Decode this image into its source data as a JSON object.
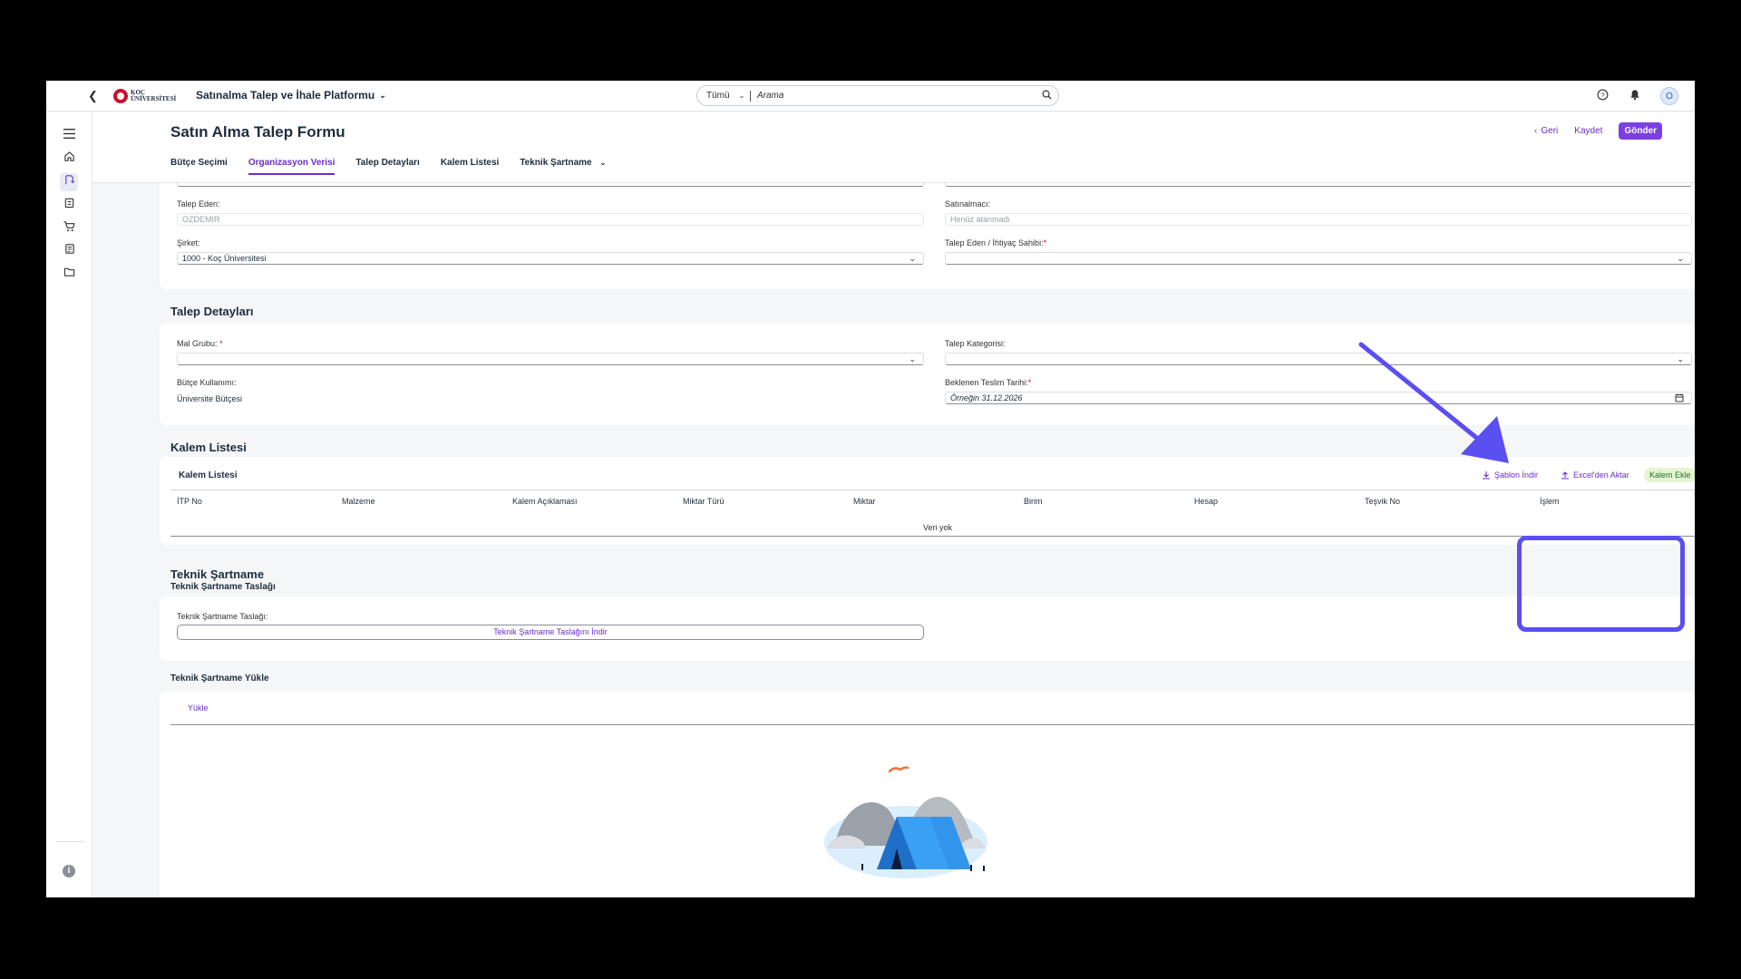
{
  "shell": {
    "logo_text_1": "KOÇ",
    "logo_text_2": "ÜNİVERSİTESİ",
    "product": "Satınalma Talep ve İhale Platformu",
    "search_scope": "Tümü",
    "search_placeholder": "Arama",
    "avatar": "O"
  },
  "header": {
    "title": "Satın Alma Talep Formu",
    "back_label": "Geri",
    "save_label": "Kaydet",
    "send_label": "Gönder"
  },
  "tabs": [
    "Bütçe Seçimi",
    "Organizasyon Verisi",
    "Talep Detayları",
    "Kalem Listesi",
    "Teknik Şartname"
  ],
  "org": {
    "talep_eden_label": "Talep Eden:",
    "talep_eden_value": "OZDEMIR",
    "satinalmaci_label": "Satınalmacı:",
    "satinalmaci_value": "Henüz atanmadı",
    "sirket_label": "Şirket:",
    "sirket_value": "1000 - Koç Üniversitesi",
    "ihtiyac_label": "Talep Eden / İhtiyaç Sahibi:",
    "ihtiyac_value": ""
  },
  "detay": {
    "title": "Talep Detayları",
    "mal_grubu_label": "Mal Grubu:",
    "mal_grubu_value": "",
    "kategori_label": "Talep Kategorisi:",
    "kategori_value": "",
    "butce_label": "Bütçe Kullanımı:",
    "butce_value": "Üniversite Bütçesi",
    "teslim_label": "Beklenen Teslim Tarihi:",
    "teslim_placeholder": "Örneğin 31.12.2026"
  },
  "kalem": {
    "section_title": "Kalem Listesi",
    "table_title": "Kalem Listesi",
    "sablon_label": "Şablon İndir",
    "excel_label": "Excel'den Aktar",
    "kalem_ekle_label": "Kalem Ekle",
    "columns": [
      "İTP No",
      "Malzeme",
      "Kalem Açıklaması",
      "Miktar Türü",
      "Miktar",
      "Birim",
      "Hesap",
      "Teşvik No",
      "İşlem"
    ],
    "empty_text": "Veri yok"
  },
  "teknik": {
    "title": "Teknik Şartname",
    "taslak_title": "Teknik Şartname Taslağı",
    "taslak_label": "Teknik Şartname Taslağı:",
    "taslak_button": "Teknik Şartname Taslağını İndir",
    "yukle_title": "Teknik Şartname Yükle",
    "yukle_tab": "Yükle"
  },
  "colors": {
    "accent": "#6a2ec8",
    "send_button": "#7b3fe4",
    "annotation": "#5a4ff0",
    "kalem_ekle_bg": "#e4f5d0"
  },
  "icons": {
    "back": "chevron-left-icon",
    "search": "search-icon",
    "help": "help-icon",
    "notifications": "bell-icon",
    "menu": "hamburger-icon",
    "home": "home-icon",
    "calendar": "calendar-icon",
    "download": "download-icon",
    "upload": "upload-icon",
    "info": "info-icon"
  }
}
